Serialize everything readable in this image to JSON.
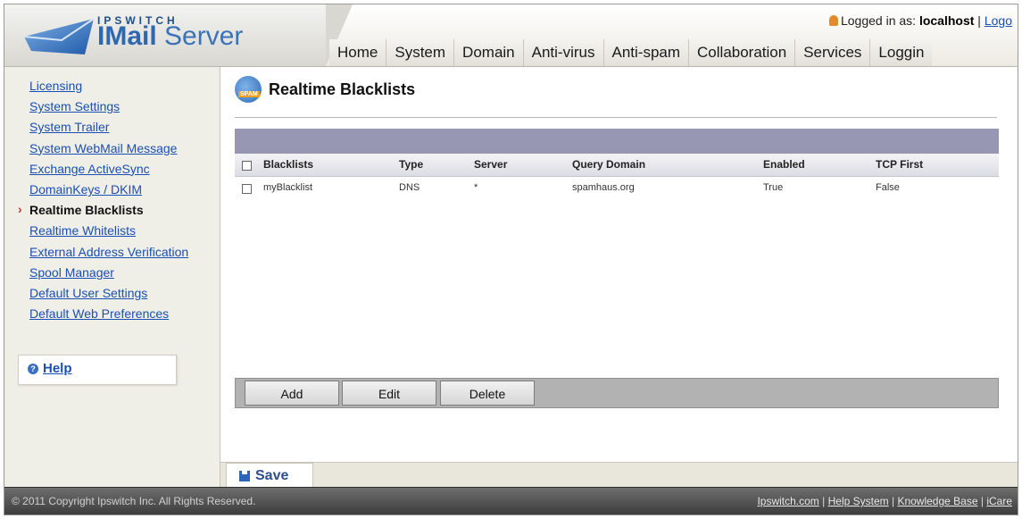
{
  "app": {
    "brand_top": "IPSWITCH",
    "brand_name_bold": "IMail",
    "brand_name_rest": " Server"
  },
  "login": {
    "prefix": "Logged in as: ",
    "user": "localhost",
    "separator": " | ",
    "logout": "Logo"
  },
  "nav": {
    "tabs": [
      "Home",
      "System",
      "Domain",
      "Anti-virus",
      "Anti-spam",
      "Collaboration",
      "Services",
      "Loggin"
    ]
  },
  "sidebar": {
    "items": [
      "Licensing",
      "System Settings",
      "System Trailer",
      "System WebMail Message",
      "Exchange ActiveSync",
      "DomainKeys / DKIM",
      "Realtime Blacklists",
      "Realtime Whitelists",
      "External Address Verification",
      "Spool Manager",
      "Default User Settings",
      "Default Web Preferences"
    ],
    "active_index": 6,
    "help_label": "Help"
  },
  "page": {
    "title": "Realtime Blacklists",
    "icon_badge": "SPAM"
  },
  "grid": {
    "columns": [
      "Blacklists",
      "Type",
      "Server",
      "Query Domain",
      "Enabled",
      "TCP First"
    ],
    "rows": [
      [
        "myBlacklist",
        "DNS",
        "*",
        "spamhaus.org",
        "True",
        "False"
      ]
    ]
  },
  "buttons": {
    "add": "Add",
    "edit": "Edit",
    "delete": "Delete",
    "save": "Save"
  },
  "footer": {
    "copyright": "© 2011 Copyright Ipswitch Inc. All Rights Reserved.",
    "links": [
      "Ipswitch.com",
      "Help System",
      "Knowledge Base",
      "iCare"
    ],
    "link_separator": " | "
  }
}
